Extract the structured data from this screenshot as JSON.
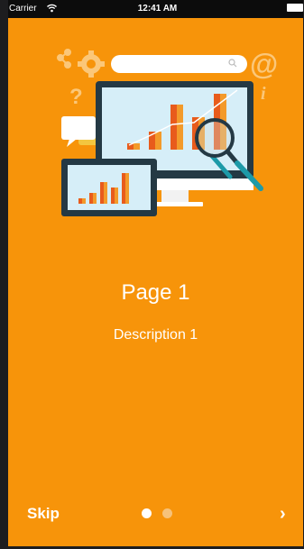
{
  "status_bar": {
    "carrier": "Carrier",
    "time": "12:41 AM",
    "wifi_icon": "wifi-icon",
    "battery_icon": "battery-icon"
  },
  "onboarding": {
    "title": "Page 1",
    "description": "Description 1",
    "skip_label": "Skip",
    "next_label": "›",
    "pages_total": 2,
    "current_page": 1
  },
  "colors": {
    "background": "#f7940a",
    "status_bar": "#0c0c0c",
    "text": "#ffffff",
    "dot_active": "#ffffff",
    "dot_inactive": "#f6c27a"
  }
}
